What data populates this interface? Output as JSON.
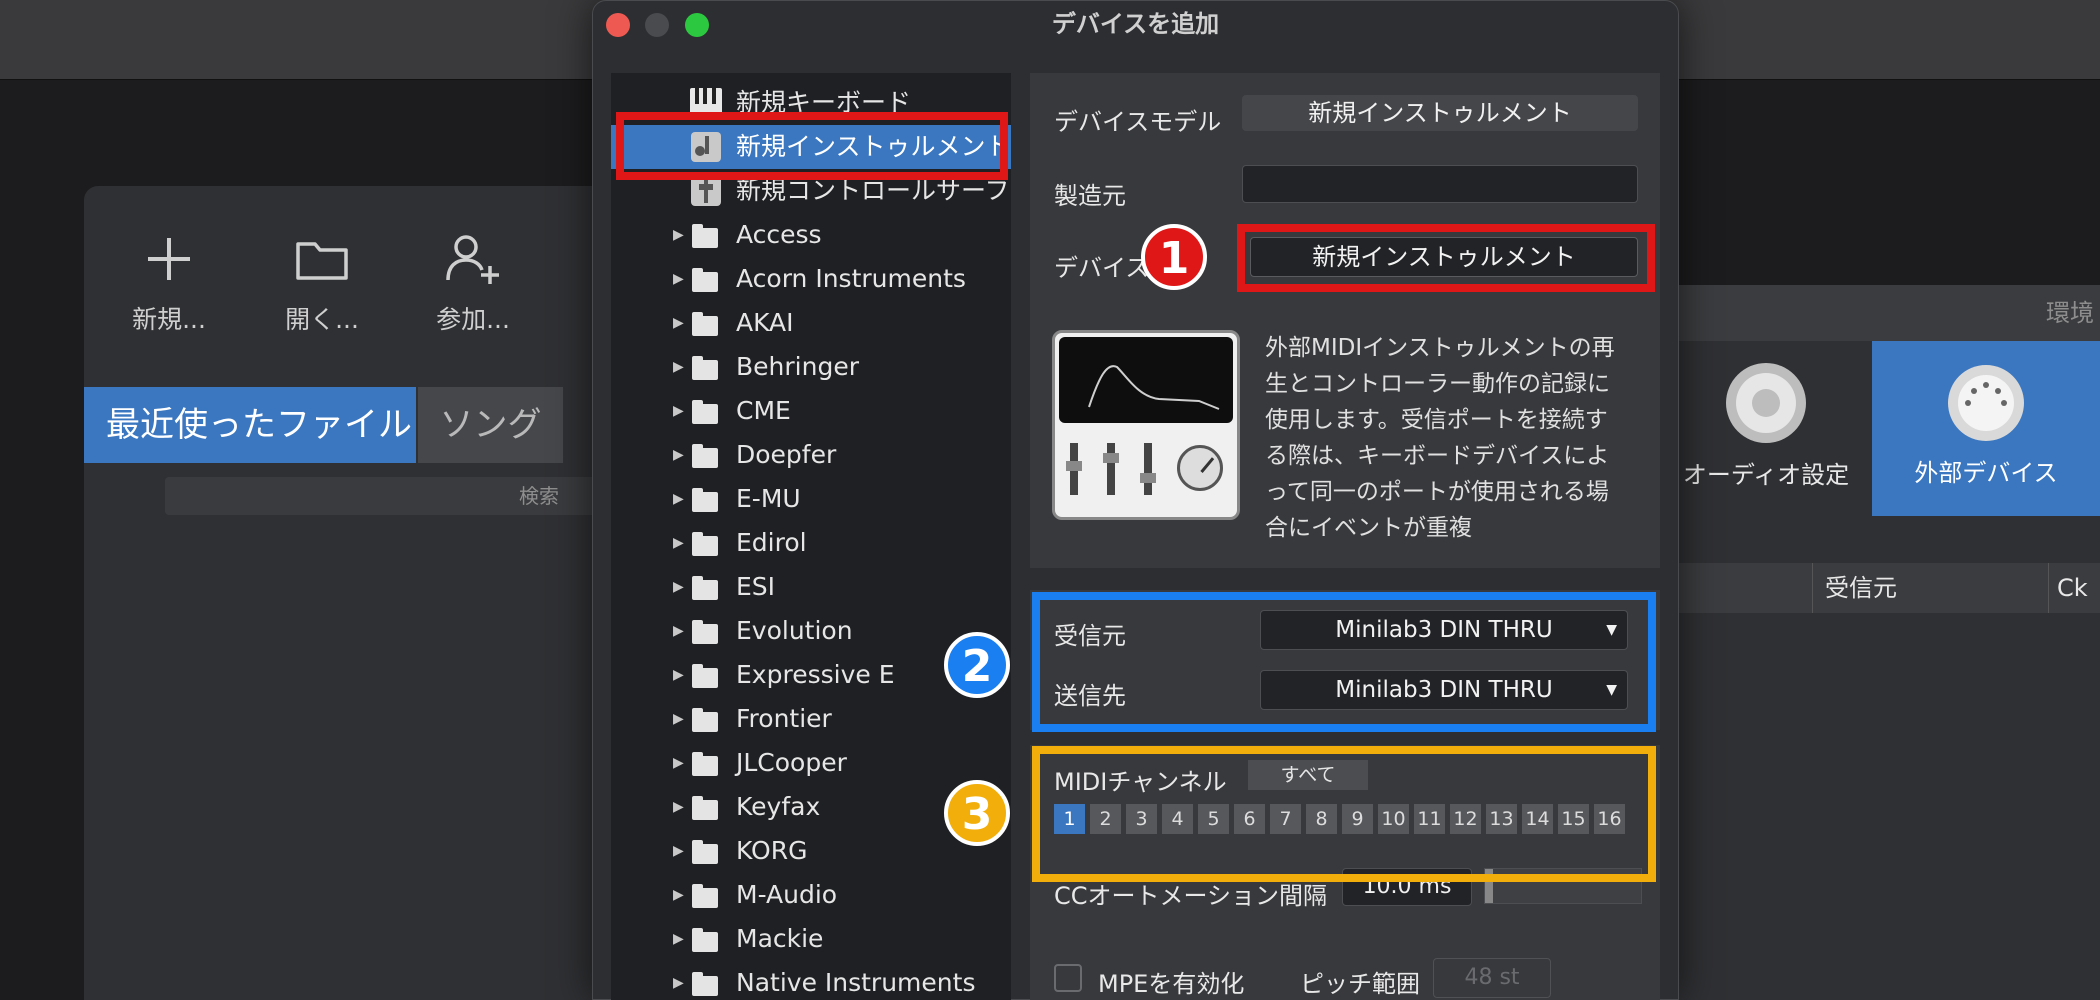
{
  "background_app": {
    "toolbar": [
      {
        "label": "新規...",
        "icon": "plus-icon"
      },
      {
        "label": "開く...",
        "icon": "folder-icon"
      },
      {
        "label": "参加...",
        "icon": "add-user-icon"
      }
    ],
    "tabs": {
      "recent": "最近使ったファイル",
      "song": "ソング"
    },
    "search_placeholder": "検索",
    "right_panel": {
      "header": "環境",
      "audio_settings": "オーディオ設定",
      "external_devices": "外部デバイス",
      "columns": [
        "受信元",
        "Ck"
      ]
    }
  },
  "dialog": {
    "title": "デバイスを追加",
    "tree": {
      "items": [
        {
          "label": "新規キーボード",
          "icon": "keyboard-icon"
        },
        {
          "label": "新規インストゥルメント",
          "icon": "instrument-icon",
          "selected": true
        },
        {
          "label": "新規コントロールサーフェ",
          "icon": "control-surface-icon"
        }
      ],
      "folders": [
        "Access",
        "Acorn Instruments",
        "AKAI",
        "Behringer",
        "CME",
        "Doepfer",
        "E-MU",
        "Edirol",
        "ESI",
        "Evolution",
        "Expressive E",
        "Frontier",
        "JLCooper",
        "Keyfax",
        "KORG",
        "M-Audio",
        "Mackie",
        "Native Instruments"
      ]
    },
    "properties": {
      "device_model_label": "デバイスモデル",
      "device_model_value": "新規インストゥルメント",
      "manufacturer_label": "製造元",
      "manufacturer_value": "",
      "device_name_label": "デバイス",
      "device_name_value": "新規インストゥルメント",
      "description": "外部MIDIインストゥルメントの再生とコントローラー動作の記録に使用します。受信ポートを接続する際は、キーボードデバイスによって同一のポートが使用される場合にイベントが重複"
    },
    "io": {
      "receive_label": "受信元",
      "receive_value": "Minilab3 DIN THRU",
      "send_label": "送信先",
      "send_value": "Minilab3 DIN THRU"
    },
    "midi": {
      "channel_label": "MIDIチャンネル",
      "all_button": "すべて",
      "channels": [
        "1",
        "2",
        "3",
        "4",
        "5",
        "6",
        "7",
        "8",
        "9",
        "10",
        "11",
        "12",
        "13",
        "14",
        "15",
        "16"
      ],
      "active_channel": "1",
      "cc_label": "CCオートメーション間隔",
      "cc_value": "10.0 ms",
      "mpe_label": "MPEを有効化",
      "pitch_label": "ピッチ範囲",
      "pitch_value": "48 st"
    }
  },
  "annotations": {
    "badge1": "1",
    "badge2": "2",
    "badge3": "3"
  },
  "colors": {
    "accent": "#3a77c0",
    "annotation_red": "#e01717",
    "annotation_blue": "#1a7ff0",
    "annotation_orange": "#f2ae0a"
  }
}
